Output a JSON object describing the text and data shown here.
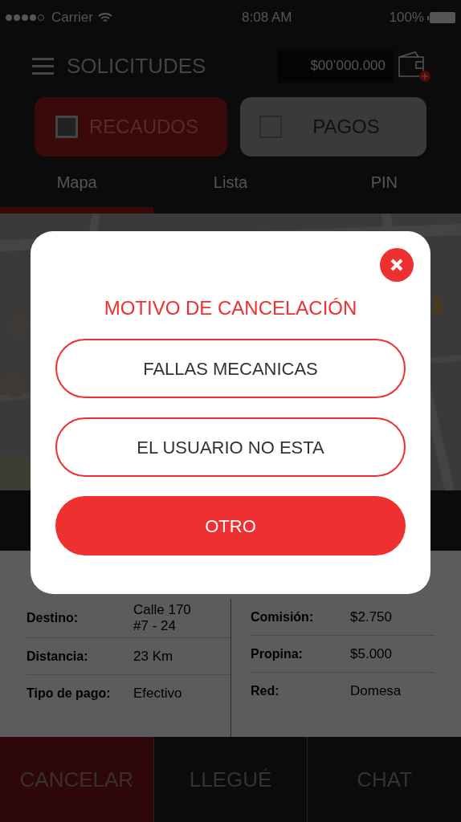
{
  "status_bar": {
    "carrier": "Carrier",
    "time": "8:08 AM",
    "battery": "100%"
  },
  "header": {
    "title": "SOLICITUDES",
    "balance": "$00’000.000"
  },
  "toggles": [
    {
      "label": "RECAUDOS",
      "selected": true
    },
    {
      "label": "PAGOS",
      "selected": false
    }
  ],
  "tabs": [
    {
      "label": "Mapa",
      "selected": true
    },
    {
      "label": "Lista",
      "selected": false
    },
    {
      "label": "PIN",
      "selected": false
    }
  ],
  "details": {
    "left": [
      {
        "label": "Destino:",
        "value": "Calle 170 #7 - 24"
      },
      {
        "label": "Distancia:",
        "value": "23 Km"
      },
      {
        "label": "Tipo de pago:",
        "value": "Efectivo"
      }
    ],
    "right": [
      {
        "label": "Comisión:",
        "value": "$2.750"
      },
      {
        "label": "Propina:",
        "value": "$5.000"
      },
      {
        "label": "Red:",
        "value": "Domesa"
      }
    ]
  },
  "bottom_bar": [
    {
      "label": "CANCELAR",
      "kind": "danger"
    },
    {
      "label": "LLEGUÉ",
      "kind": "plain"
    },
    {
      "label": "CHAT",
      "kind": "plain"
    }
  ],
  "modal": {
    "title": "MOTIVO DE CANCELACIÓN",
    "options": [
      {
        "label": "FALLAS MECANICAS",
        "kind": "outline"
      },
      {
        "label": "EL USUARIO NO ESTA",
        "kind": "outline"
      },
      {
        "label": "OTRO",
        "kind": "filled"
      }
    ]
  }
}
